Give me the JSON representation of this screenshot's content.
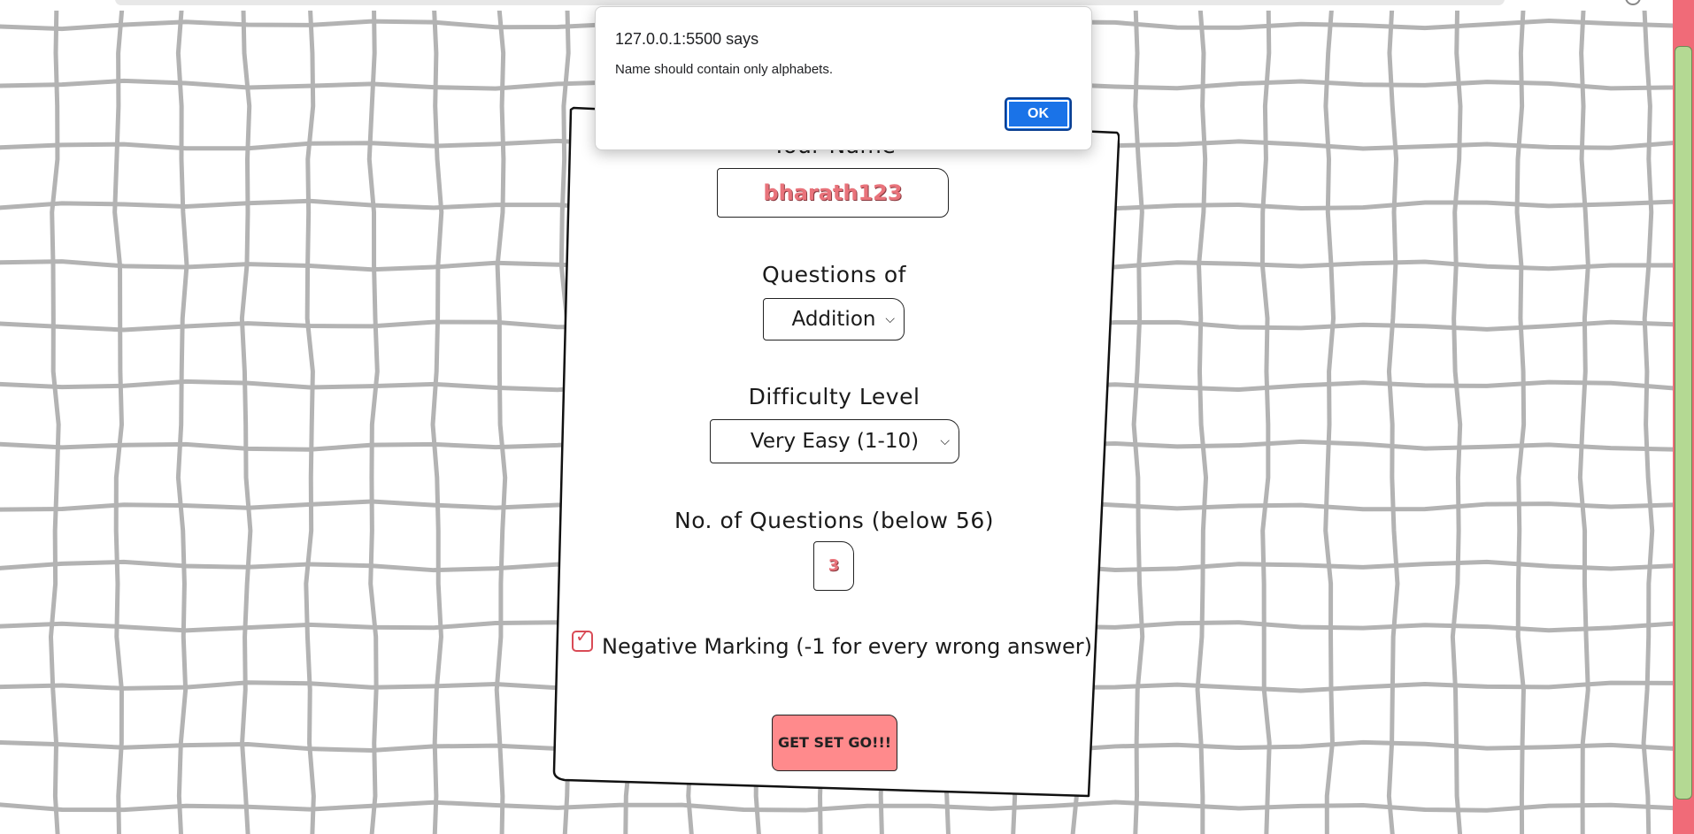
{
  "dialog": {
    "origin": "127.0.0.1:5500 says",
    "message": "Name should contain only alphabets.",
    "ok_label": "OK"
  },
  "form": {
    "name_label": "Your Name",
    "name_value": "bharath123",
    "questions_label": "Questions of",
    "questions_selected": "Addition",
    "difficulty_label": "Difficulty Level",
    "difficulty_selected": "Very Easy (1-10)",
    "count_label": "No. of Questions (below 56)",
    "count_value": "3",
    "negative_label": "Negative Marking (-1 for every wrong answer)",
    "negative_checked": true,
    "submit_label": "GET SET GO!!!"
  },
  "colors": {
    "accent": "#ff8a8c",
    "grid": "#b3b3b3",
    "scroll_track": "#f06b78",
    "scroll_thumb": "#b4d993",
    "dialog_button": "#1a73e8"
  }
}
